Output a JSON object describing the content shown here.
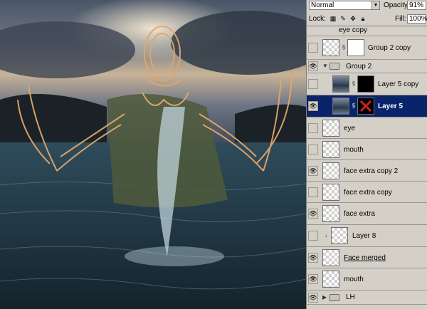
{
  "panel": {
    "blend_mode": "Normal",
    "opacity_label": "Opacity:",
    "opacity_value": "91%",
    "lock_label": "Lock:",
    "fill_label": "Fill:",
    "fill_value": "100%"
  },
  "layers": [
    {
      "name": "eye copy",
      "visible": false
    },
    {
      "name": "Group 2 copy",
      "visible": false
    },
    {
      "name": "Group 2",
      "visible": true
    },
    {
      "name": "Layer 5 copy",
      "visible": false
    },
    {
      "name": "Layer 5",
      "visible": true,
      "selected": true
    },
    {
      "name": "eye",
      "visible": false
    },
    {
      "name": "mouth",
      "visible": false
    },
    {
      "name": "face extra copy 2",
      "visible": true
    },
    {
      "name": "face extra copy",
      "visible": false
    },
    {
      "name": "face extra",
      "visible": true
    },
    {
      "name": "Layer 8",
      "visible": false
    },
    {
      "name": "Face merged",
      "visible": true
    },
    {
      "name": "mouth",
      "visible": true
    },
    {
      "name": "LH",
      "visible": true
    }
  ],
  "icons": {
    "eye": "eye-icon",
    "link": "chain-link-icon",
    "folder": "folder-icon",
    "lock_transparent": "checker-lock-icon",
    "lock_image": "brush-lock-icon",
    "lock_position": "move-lock-icon",
    "lock_all": "padlock-icon"
  },
  "colors": {
    "panel_bg": "#d4d0c8",
    "selection": "#0a246a"
  }
}
